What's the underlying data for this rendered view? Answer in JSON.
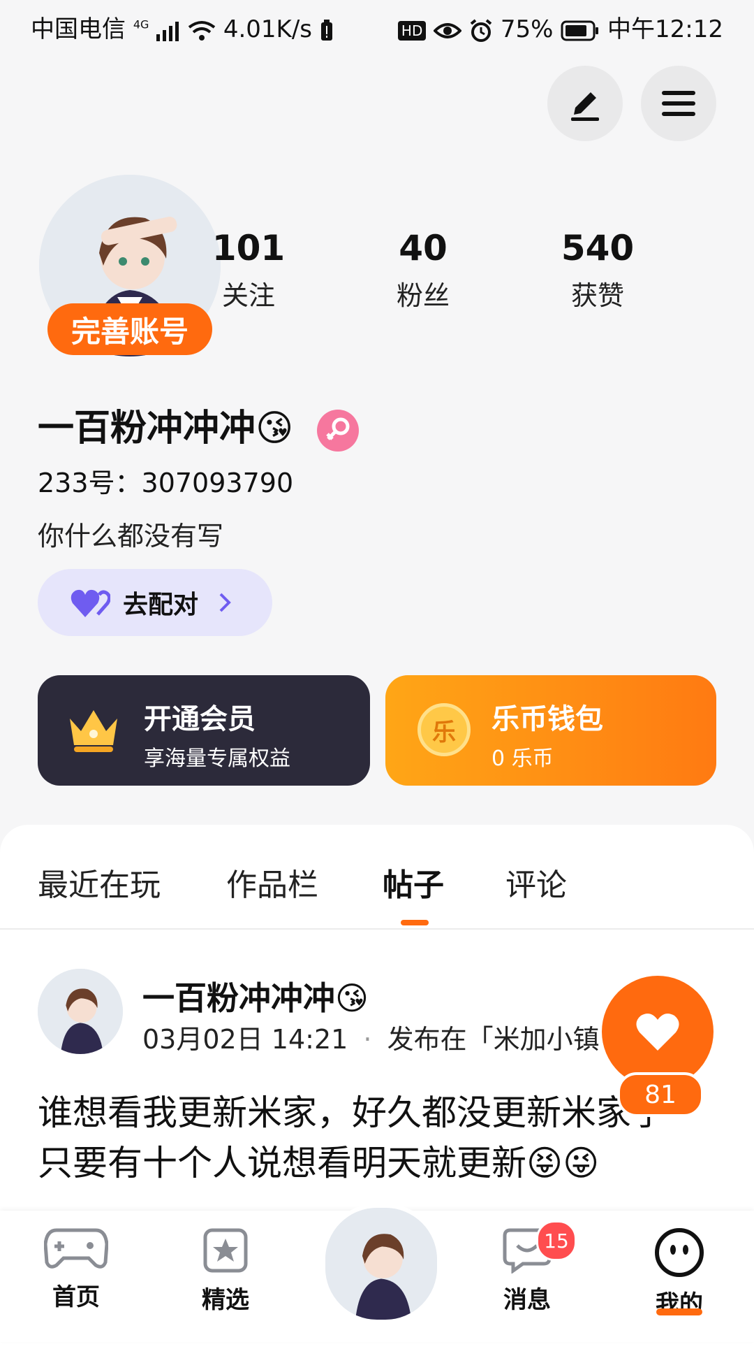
{
  "status_bar": {
    "carrier": "中国电信",
    "net_type": "4G",
    "speed": "4.01K/s",
    "hd": "HD",
    "battery": "75%",
    "time": "中午12:12"
  },
  "profile": {
    "complete_account": "完善账号",
    "stats": [
      {
        "num": "101",
        "label": "关注"
      },
      {
        "num": "40",
        "label": "粉丝"
      },
      {
        "num": "540",
        "label": "获赞"
      }
    ],
    "username": "一百粉冲冲冲😘",
    "id_line": "233号：307093790",
    "bio": "你什么都没有写",
    "match_label": "去配对"
  },
  "cards": {
    "vip": {
      "title": "开通会员",
      "subtitle": "享海量专属权益"
    },
    "wallet": {
      "title": "乐币钱包",
      "subtitle": "0 乐币",
      "coin_char": "乐"
    }
  },
  "tabs": [
    "最近在玩",
    "作品栏",
    "帖子",
    "评论"
  ],
  "active_tab": "帖子",
  "post": {
    "author": "一百粉冲冲冲😘",
    "date": "03月02日 14:21",
    "published_in": "发布在「米加小镇",
    "text_line1": "谁想看我更新米家，好久都没更新米家了",
    "text_line2": "只要有十个人说想看明天就更新😝😜",
    "likes": "81"
  },
  "nav": {
    "home": "首页",
    "featured": "精选",
    "messages": "消息",
    "messages_badge": "15",
    "mine": "我的"
  },
  "colors": {
    "accent": "#ff6a0f",
    "vip_bg": "#2c2a3a",
    "match_bg": "#e6e5fb"
  }
}
